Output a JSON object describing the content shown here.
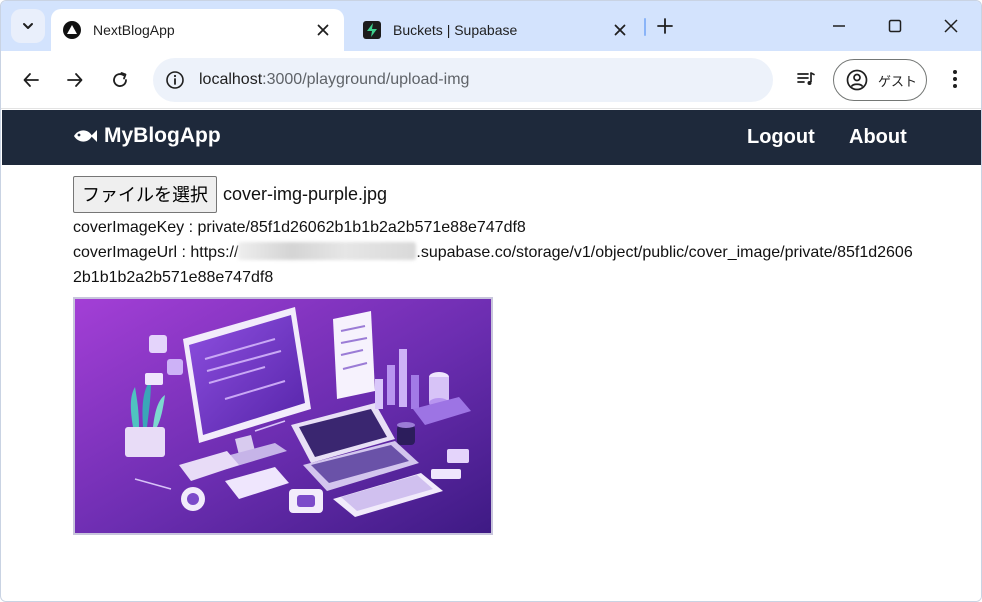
{
  "browser": {
    "tabs": [
      {
        "title": "NextBlogApp",
        "active": true,
        "favicon": "nextjs-icon"
      },
      {
        "title": "Buckets | Supabase",
        "active": false,
        "favicon": "supabase-icon"
      }
    ],
    "url_host": "localhost",
    "url_path": ":3000/playground/upload-img",
    "profile_label": "ゲスト"
  },
  "app": {
    "brand": "MyBlogApp",
    "nav": [
      {
        "label": "Logout"
      },
      {
        "label": "About"
      }
    ]
  },
  "upload": {
    "choose_file_label": "ファイルを選択",
    "file_name": "cover-img-purple.jpg",
    "key_label": "coverImageKey : ",
    "key_value": "private/85f1d26062b1b1b2a2b571e88e747df8",
    "url_label": "coverImageUrl : ",
    "url_prefix": "https://",
    "url_suffix": ".supabase.co/storage/v1/object/public/cover_image/private/85f1d26062b1b1b2a2b571e88e747df8"
  },
  "colors": {
    "tabstrip": "#d3e3fd",
    "app_header": "#1e293b",
    "preview_purple": "#6a2ea5"
  }
}
